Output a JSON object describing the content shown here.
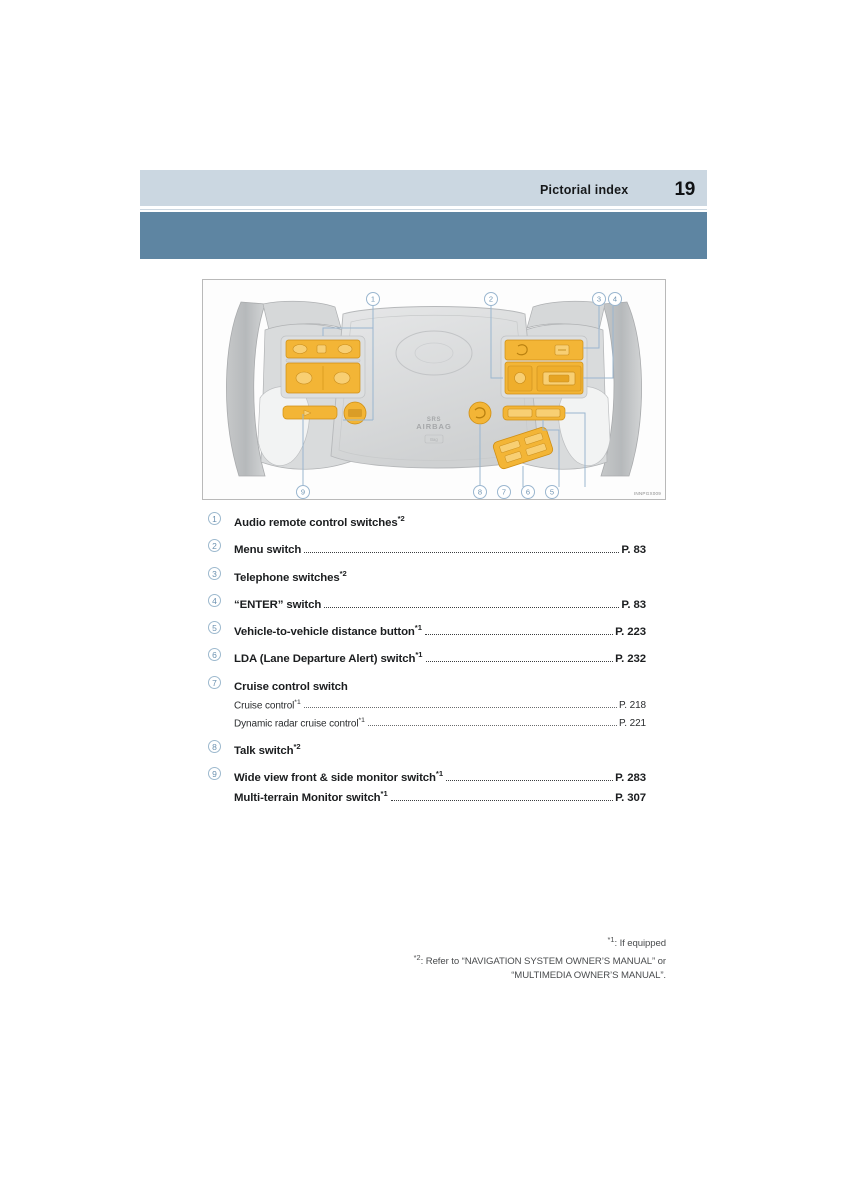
{
  "page": {
    "header_title": "Pictorial index",
    "page_number": "19",
    "accent_color": "#5e85a2",
    "band_color": "#cbd7e1"
  },
  "figure": {
    "name": "steering-wheel-switch-diagram",
    "code": "INNPGX009",
    "airbag_text_line1": "SRS",
    "airbag_text_line2": "AIRBAG",
    "callouts": [
      "1",
      "2",
      "3",
      "4",
      "5",
      "6",
      "7",
      "8",
      "9"
    ]
  },
  "index": {
    "items": [
      {
        "num": "1",
        "entries": [
          {
            "label": "Audio remote control switches",
            "sup": "*2",
            "page": "",
            "leader": false
          }
        ]
      },
      {
        "num": "2",
        "entries": [
          {
            "label": "Menu switch",
            "sup": "",
            "page": "P. 83",
            "leader": true
          }
        ]
      },
      {
        "num": "3",
        "entries": [
          {
            "label": "Telephone switches",
            "sup": "*2",
            "page": "",
            "leader": false
          }
        ]
      },
      {
        "num": "4",
        "entries": [
          {
            "label": "“ENTER” switch",
            "sup": "",
            "page": "P. 83",
            "leader": true
          }
        ]
      },
      {
        "num": "5",
        "entries": [
          {
            "label": "Vehicle-to-vehicle distance button",
            "sup": "*1",
            "page": "P. 223",
            "leader": true
          }
        ]
      },
      {
        "num": "6",
        "entries": [
          {
            "label": "LDA (Lane Departure Alert) switch",
            "sup": "*1",
            "page": "P. 232",
            "leader": true
          }
        ]
      },
      {
        "num": "7",
        "entries": [
          {
            "label": "Cruise control switch",
            "sup": "",
            "page": "",
            "leader": false
          },
          {
            "label": "Cruise control",
            "sup": "*1",
            "page": "P. 218",
            "leader": true,
            "sub": true
          },
          {
            "label": "Dynamic radar cruise control",
            "sup": "*1",
            "page": "P. 221",
            "leader": true,
            "sub": true
          }
        ]
      },
      {
        "num": "8",
        "entries": [
          {
            "label": "Talk switch",
            "sup": "*2",
            "page": "",
            "leader": false
          }
        ]
      },
      {
        "num": "9",
        "entries": [
          {
            "label": "Wide view front & side monitor switch",
            "sup": "*1",
            "page": "P. 283",
            "leader": true
          },
          {
            "label": "Multi-terrain Monitor switch",
            "sup": "*1",
            "page": "P. 307",
            "leader": true
          }
        ]
      }
    ]
  },
  "footnotes": {
    "one_sup": "*1",
    "one_text": ": If equipped",
    "two_sup": "*2",
    "two_text": ": Refer to “NAVIGATION SYSTEM OWNER’S MANUAL” or",
    "two_text_line2": "“MULTIMEDIA OWNER’S MANUAL”."
  }
}
